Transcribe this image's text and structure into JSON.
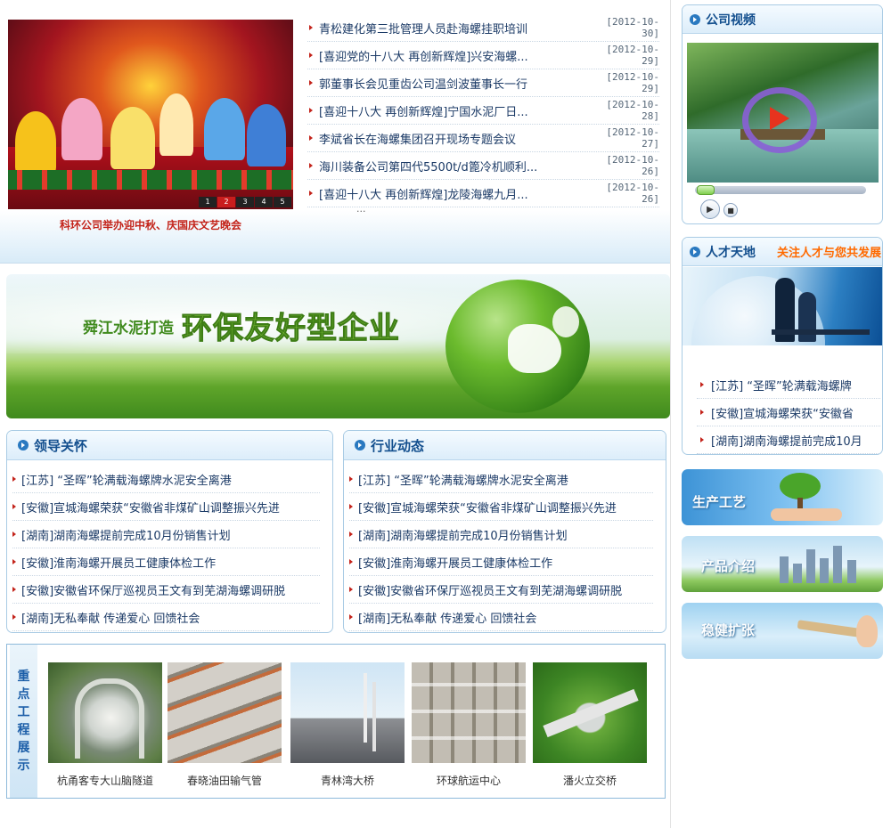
{
  "news": {
    "slide_caption": "科环公司举办迎中秋、庆国庆文艺晚会",
    "slide_numbers": [
      "1",
      "2",
      "3",
      "4",
      "5"
    ],
    "items": [
      {
        "title": "青松建化第三批管理人员赴海螺挂职培训",
        "date": "[2012-10-30]"
      },
      {
        "title": "[喜迎党的十八大 再创新辉煌]兴安海螺...",
        "date": "[2012-10-29]"
      },
      {
        "title": "郭董事长会见重齿公司温剑波董事长一行",
        "date": "[2012-10-29]"
      },
      {
        "title": "[喜迎十八大 再创新辉煌]宁国水泥厂日...",
        "date": "[2012-10-28]"
      },
      {
        "title": "李斌省长在海螺集团召开现场专题会议",
        "date": "[2012-10-27]"
      },
      {
        "title": "海川装备公司第四代5500t/d篦冷机顺利...",
        "date": "[2012-10-26]"
      },
      {
        "title": "[喜迎十八大 再创新辉煌]龙陵海螺九月...",
        "date": "[2012-10-26]"
      }
    ],
    "more": "..."
  },
  "banner": {
    "pre_text": "舜江水泥打造",
    "main_text": "环保友好型企业"
  },
  "leaders": {
    "title": "领导关怀",
    "items": [
      "[江苏] “圣晖”轮满载海螺牌水泥安全离港",
      "[安徽]宣城海螺荣获“安徽省非煤矿山调整振兴先进",
      "[湖南]湖南海螺提前完成10月份销售计划",
      "[安徽]淮南海螺开展员工健康体检工作",
      "[安徽]安徽省环保厅巡视员王文有到芜湖海螺调研脱",
      "[湖南]无私奉献 传递爱心 回馈社会"
    ]
  },
  "industry": {
    "title": "行业动态",
    "items": [
      "[江苏] “圣晖”轮满载海螺牌水泥安全离港",
      "[安徽]宣城海螺荣获“安徽省非煤矿山调整振兴先进",
      "[湖南]湖南海螺提前完成10月份销售计划",
      "[安徽]淮南海螺开展员工健康体检工作",
      "[安徽]安徽省环保厅巡视员王文有到芜湖海螺调研脱",
      "[湖南]无私奉献 传递爱心 回馈社会"
    ]
  },
  "projects": {
    "label_chars": [
      "重",
      "点",
      "工",
      "程",
      "展",
      "示"
    ],
    "items": [
      {
        "caption": "杭甬客专大山脑隧道"
      },
      {
        "caption": "春晓油田输气管"
      },
      {
        "caption": "青林湾大桥"
      },
      {
        "caption": "环球航运中心"
      },
      {
        "caption": "潘火立交桥"
      }
    ]
  },
  "video": {
    "title": "公司视频",
    "play_icon": "play-icon",
    "stop_icon": "stop-icon"
  },
  "talent": {
    "title": "人才天地",
    "subtitle": "关注人才与您共发展",
    "items": [
      "[江苏] “圣晖”轮满载海螺牌",
      "[安徽]宣城海螺荣获“安徽省",
      "[湖南]湖南海螺提前完成10月"
    ]
  },
  "side_banners": {
    "process": "生产工艺",
    "product": "产品介绍",
    "expand": "稳健扩张"
  },
  "colors": {
    "link": "#1b3a66",
    "heading": "#134f8e",
    "accent_red": "#c3231a",
    "accent_orange": "#ff6a00",
    "panel_border": "#a9cbe4"
  }
}
